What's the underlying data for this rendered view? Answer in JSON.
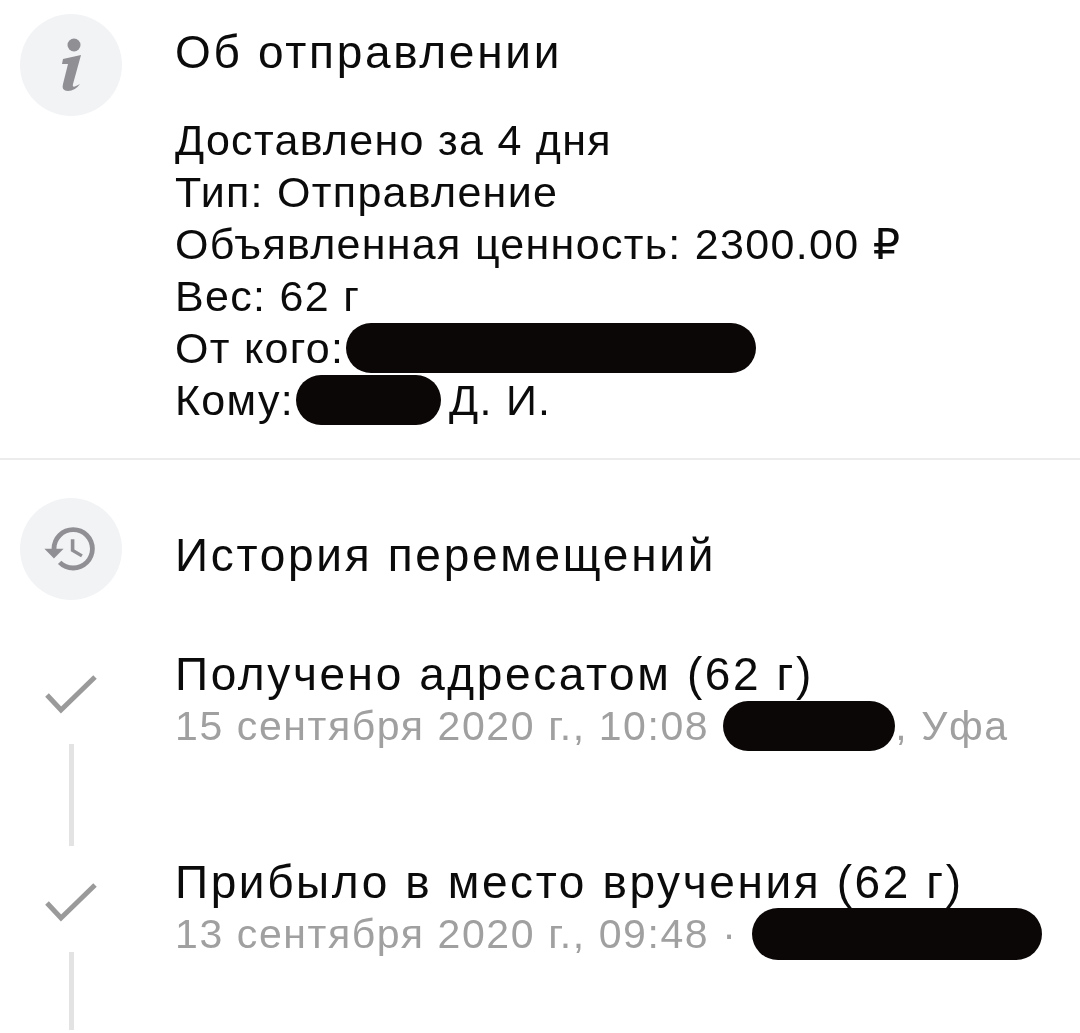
{
  "info": {
    "title": "Об отправлении",
    "lines": [
      {
        "parts": [
          {
            "kind": "text",
            "text": "Доставлено за 4 дня"
          }
        ]
      },
      {
        "parts": [
          {
            "kind": "text",
            "text": "Тип: Отправление"
          }
        ]
      },
      {
        "parts": [
          {
            "kind": "text",
            "text": "Объявленная ценность: 2300.00 ₽"
          }
        ]
      },
      {
        "parts": [
          {
            "kind": "text",
            "text": "Вес: 62 г"
          }
        ]
      },
      {
        "parts": [
          {
            "kind": "text",
            "text": "От кого:"
          },
          {
            "kind": "redaction"
          }
        ]
      },
      {
        "parts": [
          {
            "kind": "text",
            "text": "Кому:"
          },
          {
            "kind": "redaction"
          },
          {
            "kind": "text",
            "text": "Д. И."
          }
        ]
      }
    ]
  },
  "history": {
    "title": "История перемещений",
    "events": [
      {
        "title": "Получено адресатом (62 г)",
        "completed": true,
        "details": [
          {
            "kind": "text",
            "text": "15 сентября 2020 г., 10:08"
          },
          {
            "kind": "redaction"
          },
          {
            "kind": "text",
            "text": ", Уфа"
          }
        ]
      },
      {
        "title": "Прибыло в место вручения (62 г)",
        "completed": true,
        "details": [
          {
            "kind": "text",
            "text": "13 сентября 2020 г., 09:48 ·"
          },
          {
            "kind": "redaction"
          }
        ]
      }
    ]
  }
}
